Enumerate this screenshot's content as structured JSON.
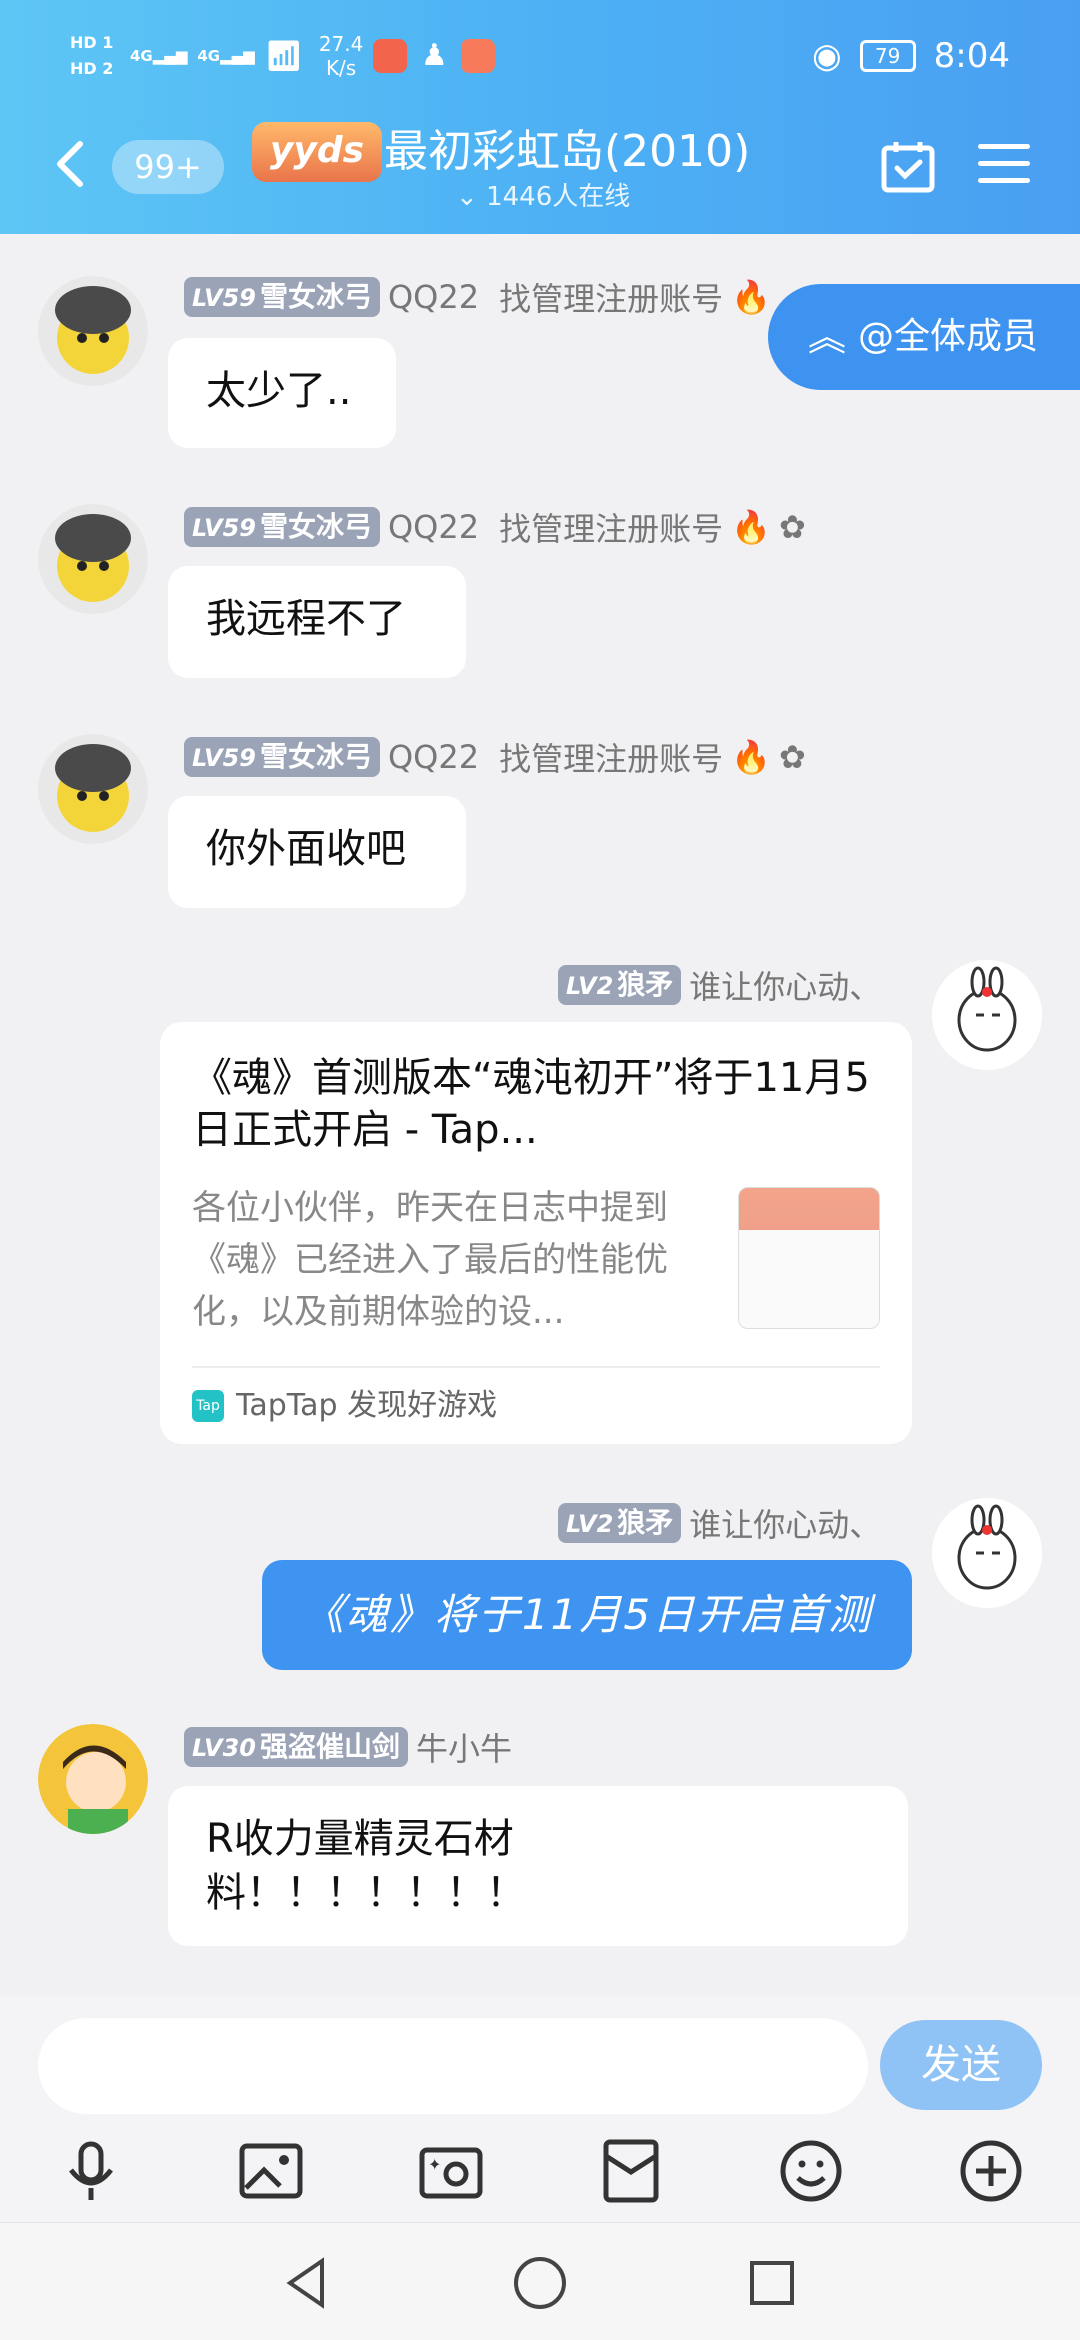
{
  "status_bar": {
    "hd1": "HD 1",
    "hd2": "HD 2",
    "net1": "4G",
    "net2": "4G",
    "speed_value": "27.4",
    "speed_unit": "K/s",
    "battery": "79",
    "time": "8:04"
  },
  "header": {
    "back_label": "<",
    "unread_count": "99+",
    "logo_text": "yyds",
    "group_name": "最初彩虹岛(2010)",
    "online_count": "1446人在线",
    "mention_all_label": "@全体成员"
  },
  "messages": [
    {
      "level": "LV59",
      "level_suffix": "雪女冰弓",
      "name": "QQ22",
      "title": "找管理注册账号",
      "text": "太少了.."
    },
    {
      "level": "LV59",
      "level_suffix": "雪女冰弓",
      "name": "QQ22",
      "title": "找管理注册账号",
      "text": "我远程不了"
    },
    {
      "level": "LV59",
      "level_suffix": "雪女冰弓",
      "name": "QQ22",
      "title": "找管理注册账号",
      "text": "你外面收吧"
    },
    {
      "level": "LV2",
      "level_suffix": "狼矛",
      "name": "谁让你心动、",
      "card": {
        "title": "《魂》首测版本“魂沌初开”将于11月5日正式开启 - Tap...",
        "description": "各位小伙伴，昨天在日志中提到《魂》已经进入了最后的性能优化，以及前期体验的设...",
        "source_icon": "Tap",
        "source": "TapTap 发现好游戏"
      }
    },
    {
      "level": "LV2",
      "level_suffix": "狼矛",
      "name": "谁让你心动、",
      "text": "《魂》将于11月5日开启首测"
    },
    {
      "level": "LV30",
      "level_suffix": "强盗催山剑",
      "name": "牛小牛",
      "text_line1": "R收力量精灵石材",
      "text_line2": "料！！！！！！！"
    }
  ],
  "composer": {
    "send_label": "发送"
  },
  "colors": {
    "header_gradient_start": "#5ec6f5",
    "header_gradient_end": "#4a9ff2",
    "accent_blue": "#3e94f0",
    "send_disabled": "#8fc3f5",
    "level_tag": "#9ba3b7"
  },
  "icons": {
    "toolbar": [
      "microphone-icon",
      "image-icon",
      "camera-icon",
      "red-packet-icon",
      "emoji-icon",
      "plus-icon"
    ],
    "system_nav": [
      "back-triangle-icon",
      "home-circle-icon",
      "recents-square-icon"
    ]
  }
}
